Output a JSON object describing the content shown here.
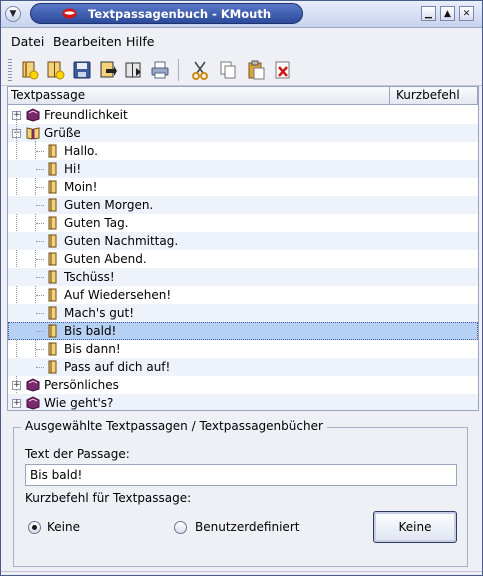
{
  "window": {
    "title": "Textpassagenbuch - KMouth",
    "controls": [
      "minimize",
      "maximize",
      "close"
    ]
  },
  "menubar": {
    "items": [
      {
        "label": "Datei"
      },
      {
        "label": "Bearbeiten"
      },
      {
        "label": "Hilfe"
      }
    ]
  },
  "toolbar": {
    "icons": [
      "new-book-icon",
      "new-passage-icon",
      "save-icon",
      "import-icon",
      "export-icon",
      "print-icon",
      "cut-icon",
      "copy-icon",
      "paste-icon",
      "delete-icon"
    ]
  },
  "tree": {
    "columns": [
      "Textpassage",
      "Kurzbefehl"
    ],
    "books": [
      {
        "label": "Freundlichkeit",
        "expanded": false
      },
      {
        "label": "Grüße",
        "expanded": true,
        "children": [
          "Hallo.",
          "Hi!",
          "Moin!",
          "Guten Morgen.",
          "Guten Tag.",
          "Guten Nachmittag.",
          "Guten Abend.",
          "Tschüss!",
          "Auf Wiedersehen!",
          "Mach's gut!",
          "Bis bald!",
          "Bis dann!",
          "Pass auf dich auf!"
        ]
      },
      {
        "label": "Persönliches",
        "expanded": false
      },
      {
        "label": "Wie geht's?",
        "expanded": false
      }
    ],
    "selected": "Bis bald!"
  },
  "details": {
    "group_title": "Ausgewählte Textpassagen / Textpassagenbücher",
    "text_label": "Text der Passage:",
    "text_value": "Bis bald!",
    "shortcut_label": "Kurzbefehl für Textpassage:",
    "radio_none": "Keine",
    "radio_custom": "Benutzerdefiniert",
    "radio_selected": "Keine",
    "shortcut_button": "Keine"
  }
}
